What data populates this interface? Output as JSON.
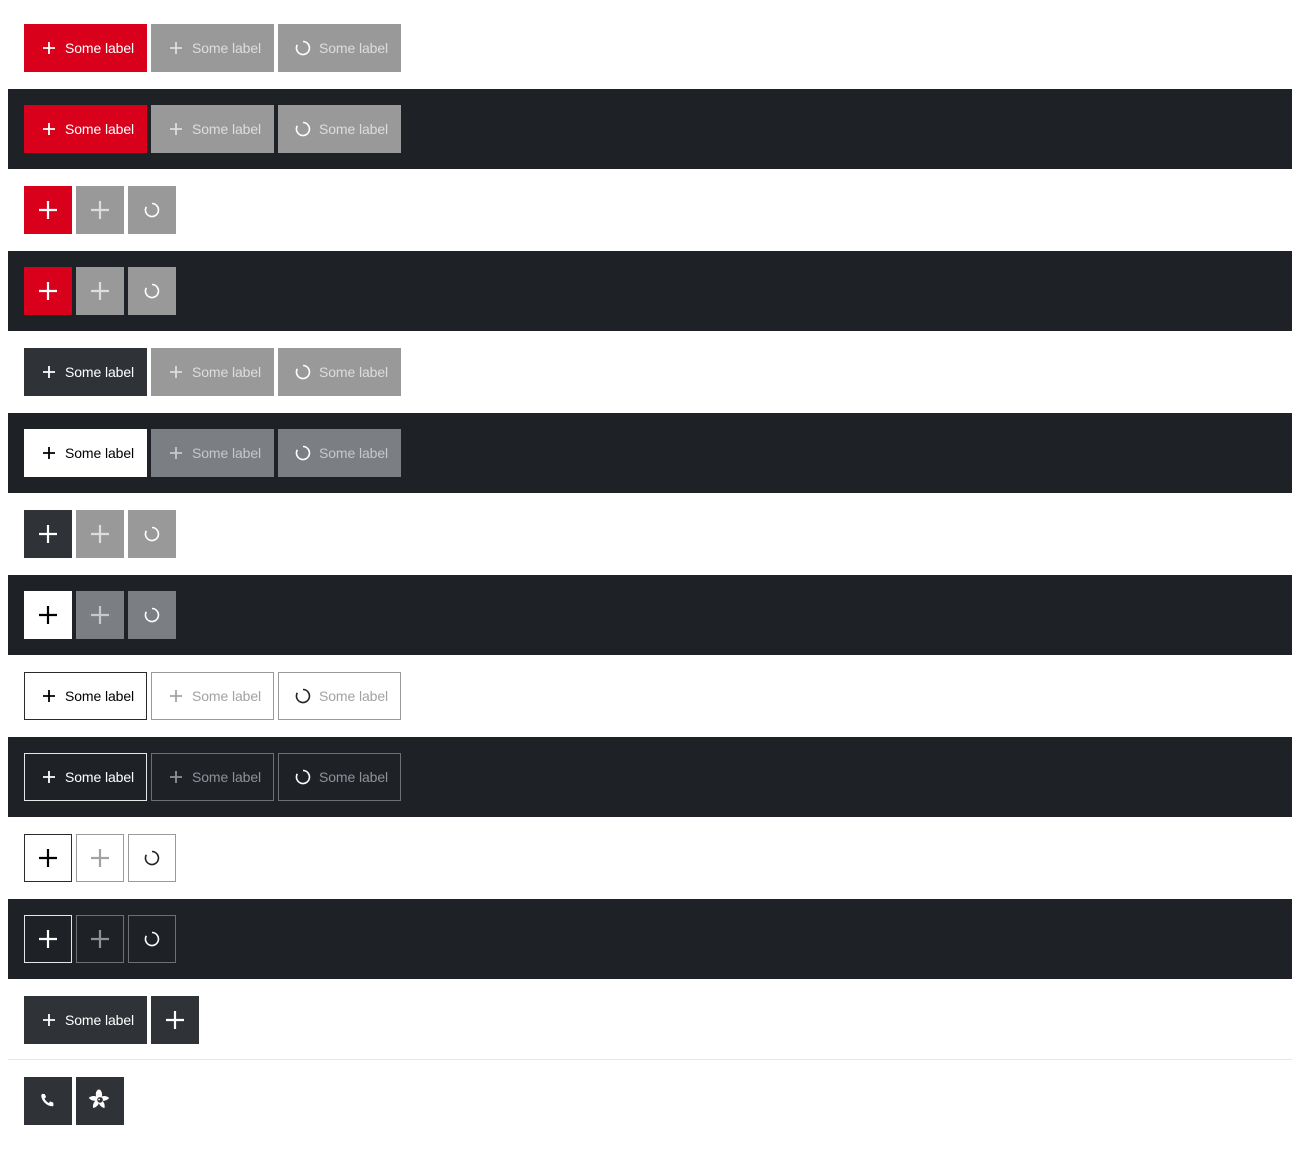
{
  "label": "Some label",
  "icons": {
    "plus": "plus-icon",
    "spinner": "spinner-icon",
    "phone": "phone-icon",
    "flower": "flower-icon"
  },
  "colors": {
    "primary_red": "#d9001b",
    "disabled_gray": "#999999",
    "dark_surface": "#1e2227",
    "dark_button": "#2f3237",
    "white": "#ffffff"
  }
}
